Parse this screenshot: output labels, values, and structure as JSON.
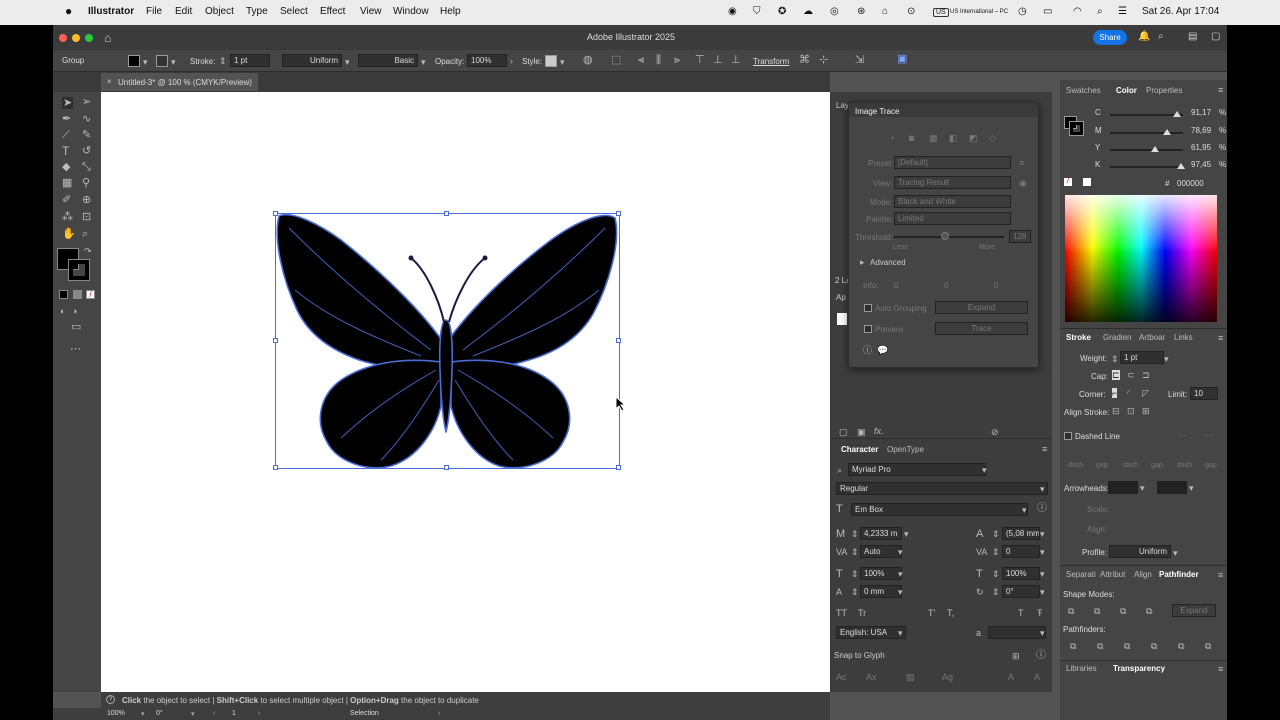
{
  "menubar": {
    "app_name": "Illustrator",
    "items": [
      "File",
      "Edit",
      "Object",
      "Type",
      "Select",
      "Effect",
      "View",
      "Window",
      "Help"
    ],
    "keyboard": "US International – PC",
    "datetime": "Sat 26. Apr  17:04"
  },
  "titlebar": {
    "title": "Adobe Illustrator 2025",
    "share_label": "Share"
  },
  "control_bar": {
    "selection_type": "Group",
    "stroke_label": "Stroke:",
    "stroke_weight": "1 pt",
    "uniform_label": "Uniform",
    "basic_label": "Basic",
    "opacity_label": "Opacity:",
    "opacity_value": "100%",
    "style_label": "Style:",
    "transform_label": "Transform"
  },
  "document": {
    "tab_title": "Untitled-3* @ 100 % (CMYK/Preview)",
    "close": "×"
  },
  "status": {
    "hint_parts": [
      "Click",
      "the object to select",
      "|",
      "Shift+Click",
      "to select multiple object",
      "|",
      "Option+Drag",
      "the object to duplicate"
    ],
    "zoom": "100%",
    "rotation": "0°",
    "artboard": "1",
    "tool": "Selection"
  },
  "image_trace": {
    "title": "Image Trace",
    "preset_label": "Preset:",
    "preset_value": "[Default]",
    "view_label": "View:",
    "view_value": "Tracing Result",
    "mode_label": "Mode:",
    "mode_value": "Black and White",
    "palette_label": "Palette:",
    "palette_value": "Limited",
    "threshold_label": "Threshold:",
    "threshold_value": "128",
    "less_label": "Less",
    "more_label": "More",
    "advanced_label": "Advanced",
    "info_label": "Info:",
    "info_values": [
      "0",
      "0",
      "0"
    ],
    "auto_grouping_label": "Auto Grouping",
    "expand_label": "Expand",
    "preview_label": "Preview",
    "trace_label": "Trace"
  },
  "layers_panel": {
    "tab_label": "Lay",
    "layers_count": "2 La",
    "appearance_tab": "Ap"
  },
  "character": {
    "tabs": [
      "Character",
      "OpenType"
    ],
    "font_family": "Myriad Pro",
    "font_style": "Regular",
    "em_box": "Em Box",
    "font_size": "4,2333 m",
    "leading": "(5,08 mm",
    "kerning": "Auto",
    "tracking": "0",
    "vscale": "100%",
    "hscale": "100%",
    "baseline": "0 mm",
    "rotation": "0°",
    "language": "English: USA",
    "aa": "a",
    "snap_label": "Snap to Glyph"
  },
  "color_panel": {
    "tabs": [
      "Swatches",
      "Color",
      "Properties"
    ],
    "c_label": "C",
    "c_value": "91,17",
    "c_level": 0.9117,
    "m_label": "M",
    "m_value": "78,69",
    "m_level": 0.7869,
    "y_label": "Y",
    "y_value": "61,95",
    "y_level": 0.6195,
    "k_label": "K",
    "k_value": "97,45",
    "k_level": 0.9745,
    "pct": "%",
    "hex_label": "#",
    "hex_value": "000000"
  },
  "stroke_panel": {
    "tabs": [
      "Stroke",
      "Gradien",
      "Artboar",
      "Links"
    ],
    "weight_label": "Weight:",
    "weight_value": "1 pt",
    "cap_label": "Cap:",
    "corner_label": "Corner:",
    "limit_label": "Limit:",
    "limit_value": "10",
    "align_label": "Align Stroke:",
    "dashed_label": "Dashed Line",
    "dash_labels": [
      "dash",
      "gap",
      "dash",
      "gap",
      "dash",
      "gap"
    ],
    "arrowheads_label": "Arrowheads:",
    "scale_label": "Scale:",
    "align_small_label": "Align:",
    "profile_label": "Profile:",
    "profile_value": "Uniform"
  },
  "pathfinder_panel": {
    "tabs": [
      "Separati",
      "Attribut",
      "Align",
      "Pathfinder"
    ],
    "shape_modes_label": "Shape Modes:",
    "expand_label": "Expand",
    "pathfinders_label": "Pathfinders:"
  },
  "bottom_tabs": [
    "Libraries",
    "Transparency"
  ],
  "colors": {
    "accent": "#1473e6",
    "selection": "#4a6cd4",
    "canvas": "#ffffff",
    "fill": "#000000"
  }
}
